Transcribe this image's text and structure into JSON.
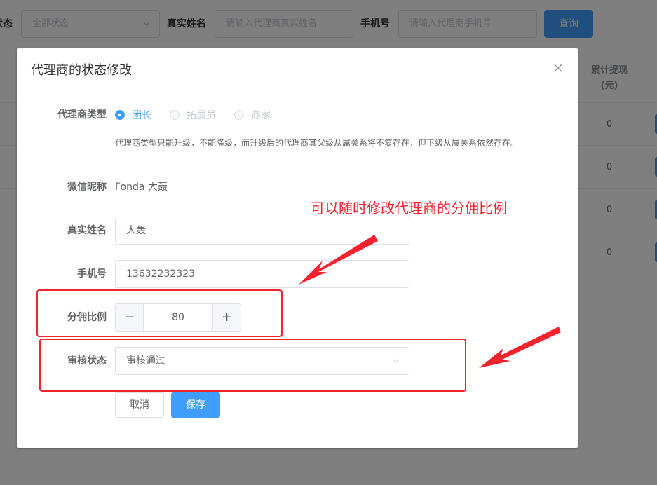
{
  "background": {
    "filters": {
      "status_label": "状态",
      "status_value": "全部状态",
      "name_label": "真实姓名",
      "name_placeholder": "请输入代理商真实姓名",
      "phone_label": "手机号",
      "phone_placeholder": "请输入代理商手机号",
      "query_button": "查询"
    },
    "table": {
      "column_header_line1": "累计提现",
      "column_header_line2": "(元)",
      "rows": [
        {
          "withdraw_total": "0"
        },
        {
          "withdraw_total": "0"
        },
        {
          "withdraw_total": "0"
        },
        {
          "withdraw_total": "0"
        }
      ]
    }
  },
  "dialog": {
    "title": "代理商的状态修改",
    "close_icon": "close-icon",
    "agent_type": {
      "label": "代理商类型",
      "options": [
        {
          "label": "团长",
          "checked": true,
          "disabled": false
        },
        {
          "label": "拓展员",
          "checked": false,
          "disabled": true
        },
        {
          "label": "商家",
          "checked": false,
          "disabled": true
        }
      ],
      "hint": "代理商类型只能升级，不能降级，而升级后的代理商其父级从属关系将不复存在，但下级从属关系依然存在。"
    },
    "wechat_nickname": {
      "label": "微信昵称",
      "value": "Fonda 大轰"
    },
    "real_name": {
      "label": "真实姓名",
      "value": "大轰"
    },
    "phone": {
      "label": "手机号",
      "value": "13632232323"
    },
    "commission_ratio": {
      "label": "分佣比例",
      "value": "80",
      "minus": "−",
      "plus": "+"
    },
    "audit_status": {
      "label": "审核状态",
      "value": "审核通过"
    },
    "cancel_button": "取消",
    "save_button": "保存"
  },
  "annotation": {
    "text": "可以随时修改代理商的分佣比例",
    "color": "#f5222d"
  },
  "colors": {
    "primary": "#409eff",
    "overlay": "rgba(0,0,0,0.5)",
    "annotation_red": "#f5222d"
  }
}
